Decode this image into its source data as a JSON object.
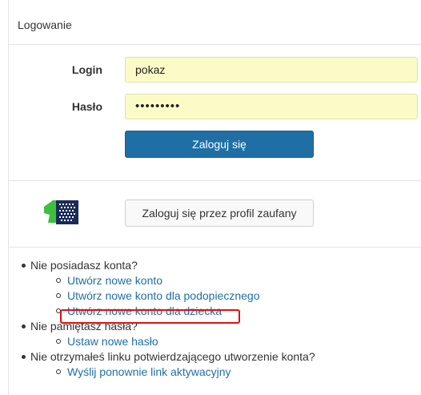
{
  "header": {
    "title": "Logowanie"
  },
  "login_form": {
    "login_label": "Login",
    "login_value": "pokaz",
    "password_label": "Hasło",
    "password_value": "•••••••••",
    "submit_label": "Zaloguj się"
  },
  "trusted_profile": {
    "logo_icon": "epuap-trusted-profile-icon",
    "button_label": "Zaloguj się przez profil zaufany"
  },
  "links": {
    "no_account": {
      "text": "Nie posiadasz konta?",
      "items": [
        "Utwórz nowe konto",
        "Utwórz nowe konto dla podopiecznego",
        "Utwórz nowe konto dla dziecka"
      ]
    },
    "forgot_password": {
      "text": "Nie pamiętasz hasła?",
      "items": [
        "Ustaw nowe hasło"
      ]
    },
    "no_activation": {
      "text": "Nie otrzymałeś linku potwierdzającego utworzenie konta?",
      "items": [
        "Wyślij ponownie link aktywacyjny"
      ]
    }
  },
  "colors": {
    "primary": "#1f6fa5",
    "input_bg": "#fbfbc7",
    "highlight": "#e01010",
    "logo_green": "#3fbf3f",
    "logo_navy": "#1a2a5a"
  }
}
